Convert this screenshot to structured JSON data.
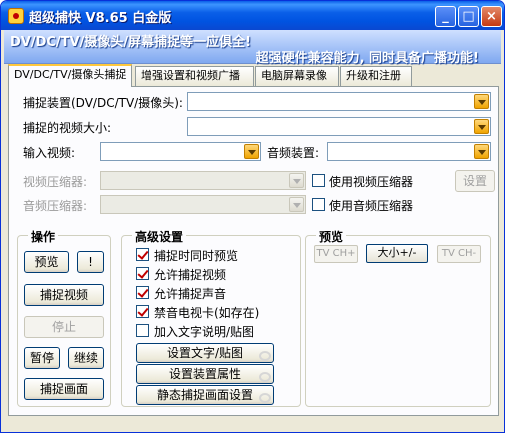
{
  "window": {
    "title": "超级捕快  V8.65 白金版",
    "minimize_glyph": "_",
    "maximize_glyph": "□",
    "close_glyph": "×"
  },
  "banner": {
    "line1": "DV/DC/TV/摄像头/屏幕捕捉等一应俱全!",
    "line2": "超强硬件兼容能力, 同时具备广播功能!"
  },
  "tabs": [
    {
      "label": "DV/DC/TV/摄像头捕捉",
      "active": true
    },
    {
      "label": "增强设置和视频广播",
      "active": false
    },
    {
      "label": "电脑屏幕录像",
      "active": false
    },
    {
      "label": "升级和注册",
      "active": false
    }
  ],
  "form": {
    "capture_device_label": "捕捉装置(DV/DC/TV/摄像头):",
    "capture_device_value": "",
    "video_size_label": "捕捉的视频大小:",
    "video_size_value": "",
    "input_video_label": "输入视频:",
    "input_video_value": "",
    "audio_device_label": "音频装置:",
    "audio_device_value": "",
    "video_compressor_label": "视频压缩器:",
    "audio_compressor_label": "音频压缩器:",
    "use_video_compressor": "使用视频压缩器",
    "use_audio_compressor": "使用音频压缩器",
    "settings_button": "设置"
  },
  "operations": {
    "title": "操作",
    "preview": "预览",
    "exclaim": "!",
    "capture_video": "捕捉视频",
    "stop": "停止",
    "pause": "暂停",
    "resume": "继续",
    "capture_frame": "捕捉画面"
  },
  "advanced": {
    "title": "高级设置",
    "options": [
      {
        "label": "捕捉时同时预览",
        "checked": true
      },
      {
        "label": "允许捕捉视频",
        "checked": true
      },
      {
        "label": "允许捕捉声音",
        "checked": true
      },
      {
        "label": "禁音电视卡(如存在)",
        "checked": true
      },
      {
        "label": "加入文字说明/贴图",
        "checked": false
      }
    ],
    "set_text_button": "设置文字/贴图",
    "device_props_button": "设置装置属性",
    "still_settings_button": "静态捕捉画面设置"
  },
  "preview": {
    "title": "预览",
    "tv_ch_up": "TV CH+",
    "size_toggle": "大小+/-",
    "tv_ch_down": "TV CH-"
  }
}
